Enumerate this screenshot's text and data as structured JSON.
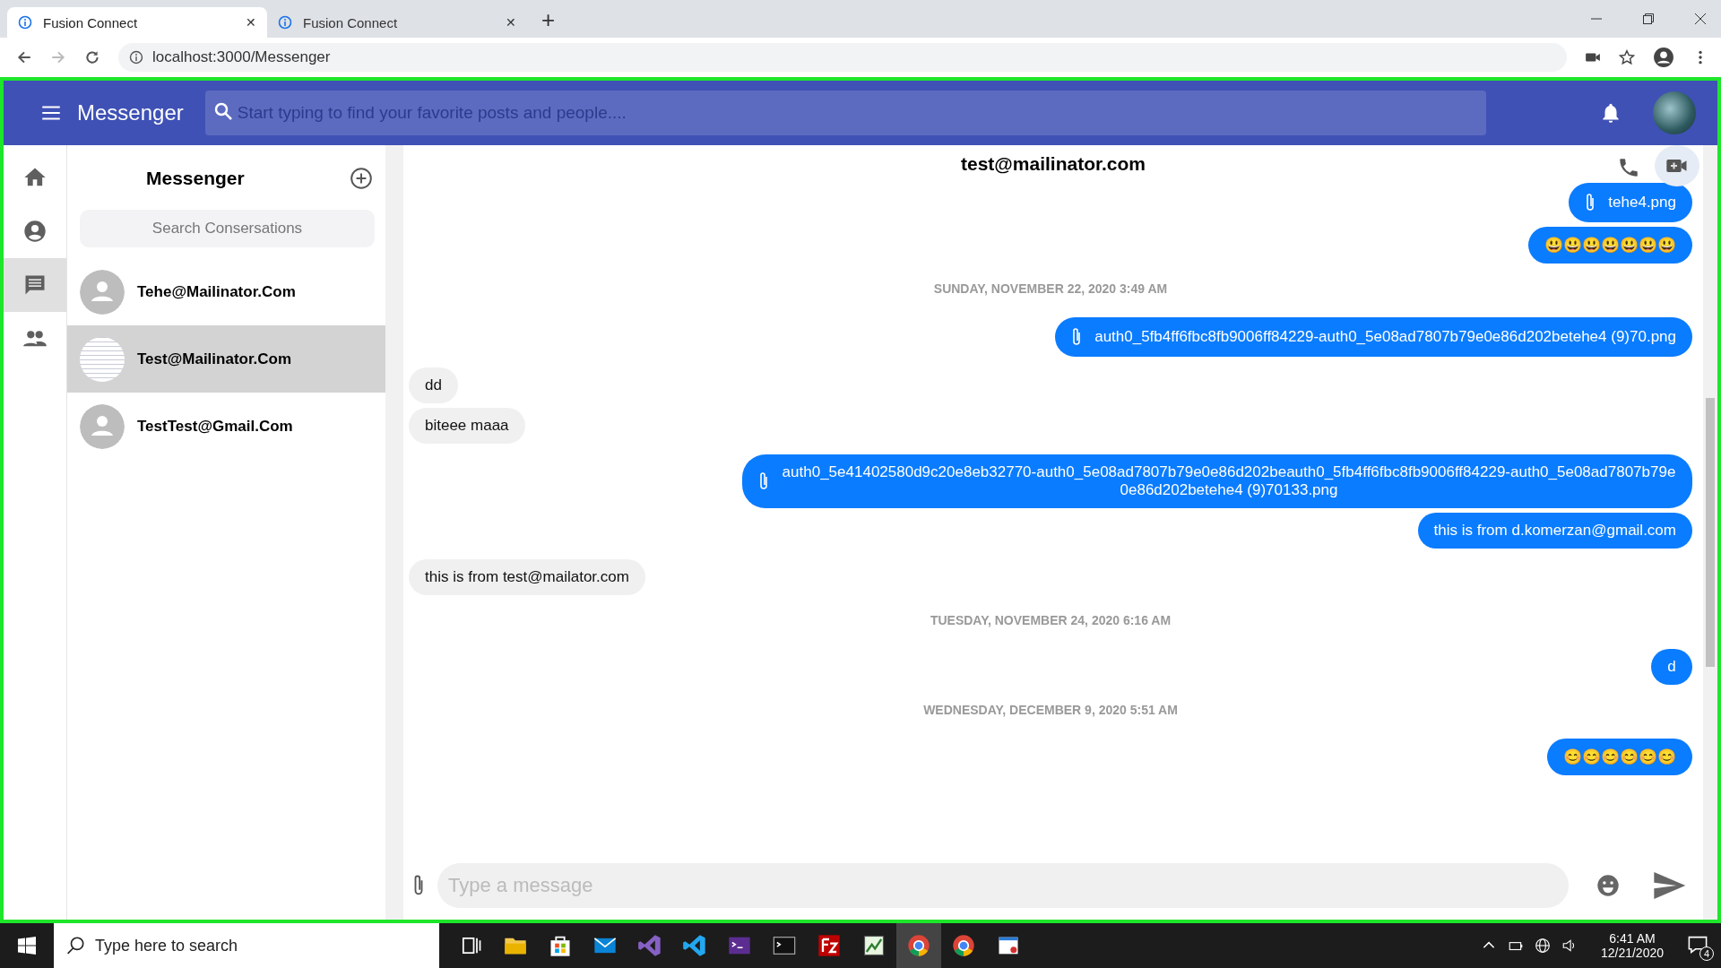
{
  "browser": {
    "tabs": [
      {
        "label": "Fusion Connect",
        "selected": true,
        "close": "✕"
      },
      {
        "label": "Fusion Connect",
        "selected": false,
        "close": "✕"
      }
    ],
    "new_tab": "+",
    "url": "localhost:3000/Messenger"
  },
  "app_bar": {
    "title": "Messenger",
    "search": {
      "placeholder": "Start typing to find your favorite posts and people...."
    }
  },
  "nav": [
    {
      "kind": "home",
      "selected": false
    },
    {
      "kind": "profile",
      "selected": false
    },
    {
      "kind": "chat",
      "selected": true
    },
    {
      "kind": "people",
      "selected": false
    }
  ],
  "conversations": {
    "title": "Messenger",
    "search": {
      "placeholder": "Search Consersations"
    },
    "items": [
      {
        "name": "Tehe@Mailinator.Com",
        "kind": "default",
        "selected": false
      },
      {
        "name": "Test@Mailinator.Com",
        "kind": "photo",
        "selected": true
      },
      {
        "name": "TestTest@Gmail.Com",
        "kind": "default",
        "selected": false
      }
    ]
  },
  "chat": {
    "title": "test@mailinator.com",
    "messages": [
      {
        "kind": "out",
        "text": "tehe4.png",
        "attachment": true
      },
      {
        "kind": "out",
        "text": "😃😃😃😃😃😃😃",
        "attachment": false
      },
      {
        "kind": "date",
        "text": "SUNDAY, NOVEMBER 22, 2020 3:49 AM"
      },
      {
        "kind": "out",
        "text": "auth0_5fb4ff6fbc8fb9006ff84229-auth0_5e08ad7807b79e0e86d202betehe4 (9)70.png",
        "attachment": true
      },
      {
        "kind": "in",
        "text": "dd",
        "attachment": false
      },
      {
        "kind": "in",
        "text": "biteee maaa",
        "attachment": false
      },
      {
        "kind": "out",
        "text": "auth0_5e41402580d9c20e8eb32770-auth0_5e08ad7807b79e0e86d202beauth0_5fb4ff6fbc8fb9006ff84229-auth0_5e08ad7807b79e0e86d202betehe4 (9)70133.png",
        "attachment": true
      },
      {
        "kind": "out",
        "text": "this is from d.komerzan@gmail.com",
        "attachment": false
      },
      {
        "kind": "in",
        "text": "this is from test@mailator.com",
        "attachment": false
      },
      {
        "kind": "date",
        "text": "TUESDAY, NOVEMBER 24, 2020 6:16 AM"
      },
      {
        "kind": "out",
        "text": "d",
        "attachment": false
      },
      {
        "kind": "date",
        "text": "WEDNESDAY, DECEMBER 9, 2020 5:51 AM"
      },
      {
        "kind": "out",
        "text": "😊😊😊😊😊😊",
        "attachment": false
      }
    ],
    "input": {
      "placeholder": "Type a message"
    }
  },
  "taskbar": {
    "search": {
      "placeholder": "Type here to search"
    },
    "time": "6:41 AM",
    "date": "12/21/2020",
    "notifications": "4"
  }
}
